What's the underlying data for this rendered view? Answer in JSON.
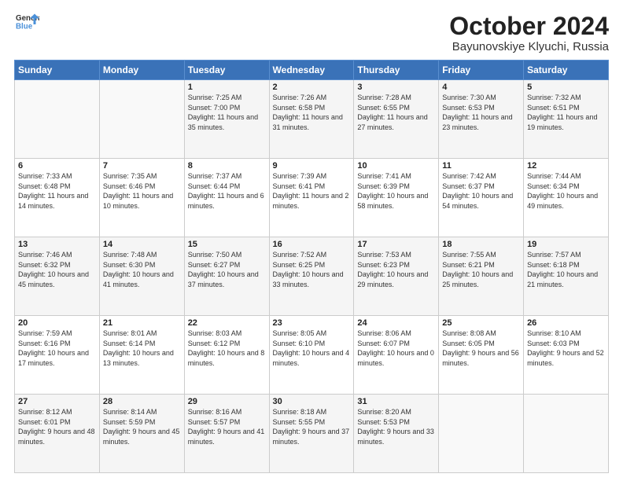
{
  "logo": {
    "line1": "General",
    "line2": "Blue"
  },
  "title": "October 2024",
  "subtitle": "Bayunovskiye Klyuchi, Russia",
  "days_of_week": [
    "Sunday",
    "Monday",
    "Tuesday",
    "Wednesday",
    "Thursday",
    "Friday",
    "Saturday"
  ],
  "weeks": [
    [
      {
        "day": "",
        "info": ""
      },
      {
        "day": "",
        "info": ""
      },
      {
        "day": "1",
        "info": "Sunrise: 7:25 AM\nSunset: 7:00 PM\nDaylight: 11 hours and 35 minutes."
      },
      {
        "day": "2",
        "info": "Sunrise: 7:26 AM\nSunset: 6:58 PM\nDaylight: 11 hours and 31 minutes."
      },
      {
        "day": "3",
        "info": "Sunrise: 7:28 AM\nSunset: 6:55 PM\nDaylight: 11 hours and 27 minutes."
      },
      {
        "day": "4",
        "info": "Sunrise: 7:30 AM\nSunset: 6:53 PM\nDaylight: 11 hours and 23 minutes."
      },
      {
        "day": "5",
        "info": "Sunrise: 7:32 AM\nSunset: 6:51 PM\nDaylight: 11 hours and 19 minutes."
      }
    ],
    [
      {
        "day": "6",
        "info": "Sunrise: 7:33 AM\nSunset: 6:48 PM\nDaylight: 11 hours and 14 minutes."
      },
      {
        "day": "7",
        "info": "Sunrise: 7:35 AM\nSunset: 6:46 PM\nDaylight: 11 hours and 10 minutes."
      },
      {
        "day": "8",
        "info": "Sunrise: 7:37 AM\nSunset: 6:44 PM\nDaylight: 11 hours and 6 minutes."
      },
      {
        "day": "9",
        "info": "Sunrise: 7:39 AM\nSunset: 6:41 PM\nDaylight: 11 hours and 2 minutes."
      },
      {
        "day": "10",
        "info": "Sunrise: 7:41 AM\nSunset: 6:39 PM\nDaylight: 10 hours and 58 minutes."
      },
      {
        "day": "11",
        "info": "Sunrise: 7:42 AM\nSunset: 6:37 PM\nDaylight: 10 hours and 54 minutes."
      },
      {
        "day": "12",
        "info": "Sunrise: 7:44 AM\nSunset: 6:34 PM\nDaylight: 10 hours and 49 minutes."
      }
    ],
    [
      {
        "day": "13",
        "info": "Sunrise: 7:46 AM\nSunset: 6:32 PM\nDaylight: 10 hours and 45 minutes."
      },
      {
        "day": "14",
        "info": "Sunrise: 7:48 AM\nSunset: 6:30 PM\nDaylight: 10 hours and 41 minutes."
      },
      {
        "day": "15",
        "info": "Sunrise: 7:50 AM\nSunset: 6:27 PM\nDaylight: 10 hours and 37 minutes."
      },
      {
        "day": "16",
        "info": "Sunrise: 7:52 AM\nSunset: 6:25 PM\nDaylight: 10 hours and 33 minutes."
      },
      {
        "day": "17",
        "info": "Sunrise: 7:53 AM\nSunset: 6:23 PM\nDaylight: 10 hours and 29 minutes."
      },
      {
        "day": "18",
        "info": "Sunrise: 7:55 AM\nSunset: 6:21 PM\nDaylight: 10 hours and 25 minutes."
      },
      {
        "day": "19",
        "info": "Sunrise: 7:57 AM\nSunset: 6:18 PM\nDaylight: 10 hours and 21 minutes."
      }
    ],
    [
      {
        "day": "20",
        "info": "Sunrise: 7:59 AM\nSunset: 6:16 PM\nDaylight: 10 hours and 17 minutes."
      },
      {
        "day": "21",
        "info": "Sunrise: 8:01 AM\nSunset: 6:14 PM\nDaylight: 10 hours and 13 minutes."
      },
      {
        "day": "22",
        "info": "Sunrise: 8:03 AM\nSunset: 6:12 PM\nDaylight: 10 hours and 8 minutes."
      },
      {
        "day": "23",
        "info": "Sunrise: 8:05 AM\nSunset: 6:10 PM\nDaylight: 10 hours and 4 minutes."
      },
      {
        "day": "24",
        "info": "Sunrise: 8:06 AM\nSunset: 6:07 PM\nDaylight: 10 hours and 0 minutes."
      },
      {
        "day": "25",
        "info": "Sunrise: 8:08 AM\nSunset: 6:05 PM\nDaylight: 9 hours and 56 minutes."
      },
      {
        "day": "26",
        "info": "Sunrise: 8:10 AM\nSunset: 6:03 PM\nDaylight: 9 hours and 52 minutes."
      }
    ],
    [
      {
        "day": "27",
        "info": "Sunrise: 8:12 AM\nSunset: 6:01 PM\nDaylight: 9 hours and 48 minutes."
      },
      {
        "day": "28",
        "info": "Sunrise: 8:14 AM\nSunset: 5:59 PM\nDaylight: 9 hours and 45 minutes."
      },
      {
        "day": "29",
        "info": "Sunrise: 8:16 AM\nSunset: 5:57 PM\nDaylight: 9 hours and 41 minutes."
      },
      {
        "day": "30",
        "info": "Sunrise: 8:18 AM\nSunset: 5:55 PM\nDaylight: 9 hours and 37 minutes."
      },
      {
        "day": "31",
        "info": "Sunrise: 8:20 AM\nSunset: 5:53 PM\nDaylight: 9 hours and 33 minutes."
      },
      {
        "day": "",
        "info": ""
      },
      {
        "day": "",
        "info": ""
      }
    ]
  ]
}
